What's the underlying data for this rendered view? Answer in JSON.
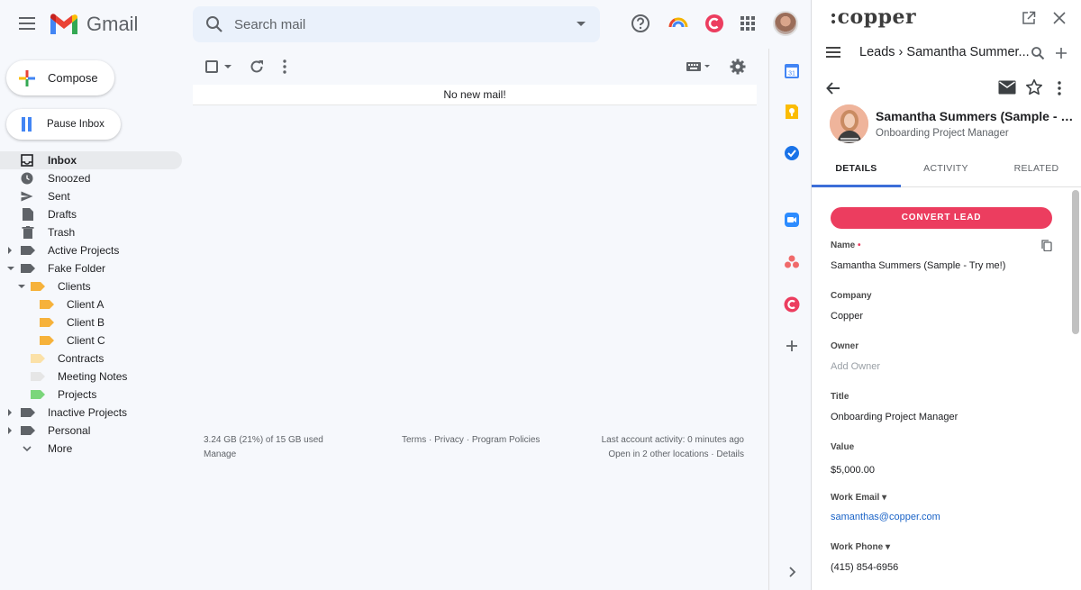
{
  "app": {
    "name": "Gmail"
  },
  "search": {
    "placeholder": "Search mail"
  },
  "sidebar": {
    "compose_label": "Compose",
    "pause_label": "Pause Inbox",
    "items": [
      {
        "label": "Inbox"
      },
      {
        "label": "Snoozed"
      },
      {
        "label": "Sent"
      },
      {
        "label": "Drafts"
      },
      {
        "label": "Trash"
      },
      {
        "label": "Active Projects"
      },
      {
        "label": "Fake Folder"
      },
      {
        "label": "Clients"
      },
      {
        "label": "Client A"
      },
      {
        "label": "Client B"
      },
      {
        "label": "Client C"
      },
      {
        "label": "Contracts"
      },
      {
        "label": "Meeting Notes"
      },
      {
        "label": "Projects"
      },
      {
        "label": "Inactive Projects"
      },
      {
        "label": "Personal"
      },
      {
        "label": "More"
      }
    ]
  },
  "main": {
    "empty_message": "No new mail!",
    "footer": {
      "storage": "3.24 GB (21%) of 15 GB used",
      "manage": "Manage",
      "terms": "Terms",
      "privacy": "Privacy",
      "policies": "Program Policies",
      "sep": "·",
      "last_activity": "Last account activity: 0 minutes ago",
      "open_in": "Open in 2 other locations",
      "details": "Details"
    }
  },
  "colors": {
    "copper_accent": "#ec3d5f",
    "tab_underline": "#3c6ed8",
    "folder_orange": "#f6b23b",
    "folder_light_orange": "#fbe1a8",
    "folder_gray": "#e6e6e6",
    "folder_green": "#7bd67b"
  },
  "copper": {
    "logo": ":copper",
    "breadcrumb_root": "Leads",
    "breadcrumb_sep": "›",
    "breadcrumb_current": "Samantha Summer...",
    "contact_name": "Samantha Summers (Sample - Try me!)",
    "contact_role": "Onboarding Project Manager",
    "tabs": [
      {
        "label": "DETAILS"
      },
      {
        "label": "ACTIVITY"
      },
      {
        "label": "RELATED"
      }
    ],
    "convert_label": "CONVERT LEAD",
    "fields": {
      "name_label": "Name",
      "name_value": "Samantha Summers (Sample - Try me!)",
      "company_label": "Company",
      "company_value": "Copper",
      "owner_label": "Owner",
      "owner_placeholder": "Add Owner",
      "title_label": "Title",
      "title_value": "Onboarding Project Manager",
      "value_label": "Value",
      "value_value": "$5,000.00",
      "email_label": "Work Email",
      "email_value": "samanthas@copper.com",
      "phone_label": "Work Phone",
      "phone_value": "(415) 854-6956"
    }
  }
}
